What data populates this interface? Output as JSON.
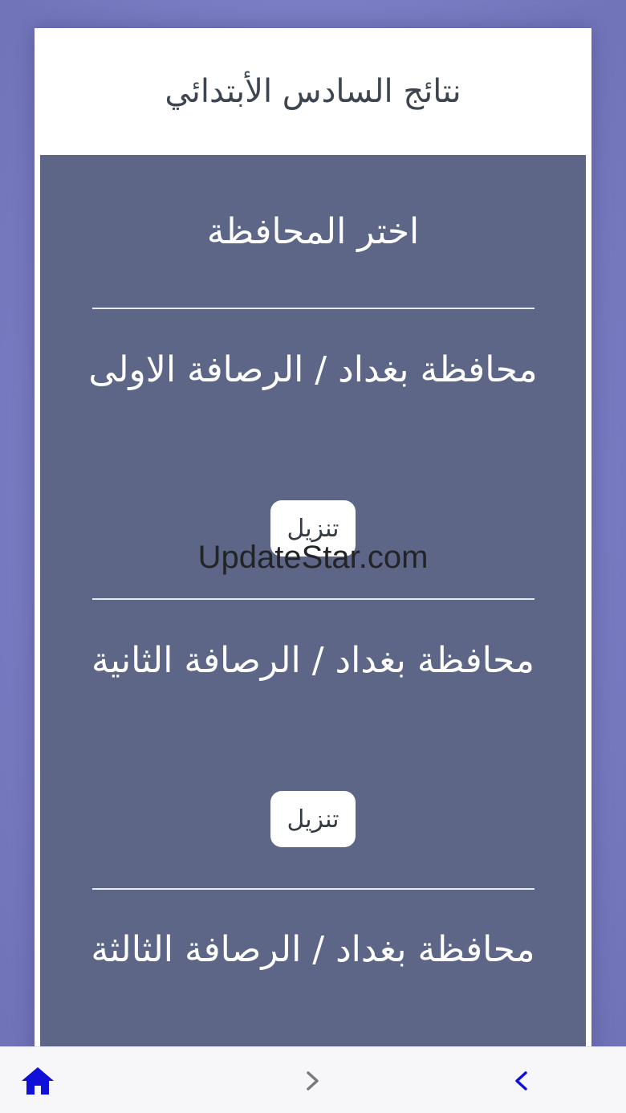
{
  "header": {
    "title": "نتائج السادس الأبتدائي"
  },
  "panel": {
    "heading": "اختر المحافظة",
    "items": [
      {
        "title": "محافظة بغداد / الرصافة الاولى",
        "button_label": "تنزيل"
      },
      {
        "title": "محافظة بغداد / الرصافة الثانية",
        "button_label": "تنزيل"
      },
      {
        "title": "محافظة بغداد / الرصافة الثالثة"
      }
    ]
  },
  "watermark": "UpdateStar.com",
  "bottom_nav": {
    "home_icon": "home-icon",
    "forward_icon": "chevron-right-icon",
    "back_icon": "chevron-left-icon"
  },
  "colors": {
    "background": "#7c7fc6",
    "panel": "#5d6686",
    "home_icon": "#1010d8",
    "forward_icon": "#7a7a7a",
    "back_icon": "#1010d8"
  }
}
